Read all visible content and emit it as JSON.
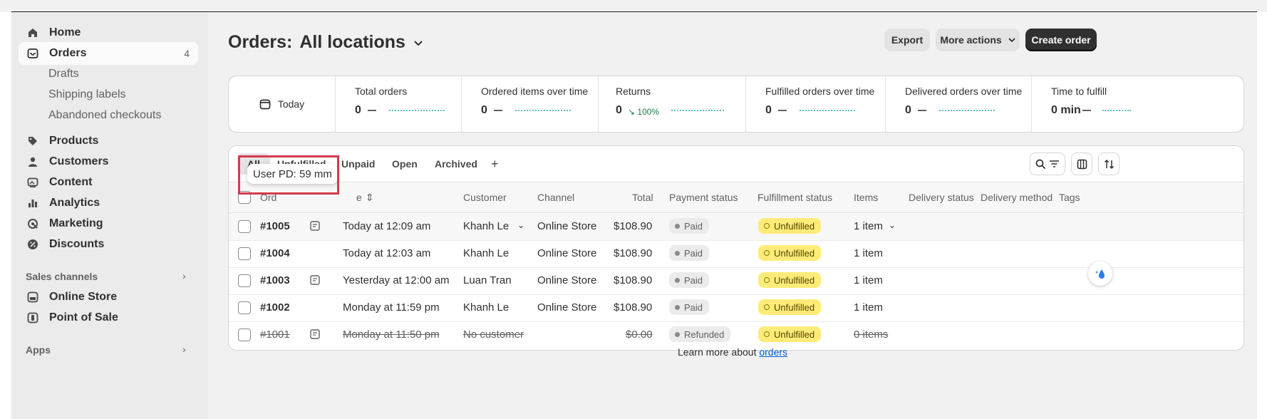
{
  "sidebar": {
    "items": [
      {
        "label": "Home",
        "icon": "home-icon"
      },
      {
        "label": "Orders",
        "icon": "orders-icon",
        "badge": "4"
      },
      {
        "label": "Products",
        "icon": "tag-icon"
      },
      {
        "label": "Customers",
        "icon": "person-icon"
      },
      {
        "label": "Content",
        "icon": "image-icon"
      },
      {
        "label": "Analytics",
        "icon": "bar-chart-icon"
      },
      {
        "label": "Marketing",
        "icon": "target-icon"
      },
      {
        "label": "Discounts",
        "icon": "discount-icon"
      }
    ],
    "orders_sub": [
      "Drafts",
      "Shipping labels",
      "Abandoned checkouts"
    ],
    "sales_channels_label": "Sales channels",
    "sales_channels": [
      {
        "label": "Online Store",
        "icon": "store-icon"
      },
      {
        "label": "Point of Sale",
        "icon": "pos-icon"
      }
    ],
    "apps_label": "Apps"
  },
  "header": {
    "title": "Orders:",
    "location": "All locations",
    "export_label": "Export",
    "more_actions_label": "More actions",
    "create_label": "Create order"
  },
  "metrics": {
    "date_label": "Today",
    "items": [
      {
        "label": "Total orders",
        "value": "0"
      },
      {
        "label": "Ordered items over time",
        "value": "0"
      },
      {
        "label": "Returns",
        "value": "0",
        "pct": "100%"
      },
      {
        "label": "Fulfilled orders over time",
        "value": "0"
      },
      {
        "label": "Delivered orders over time",
        "value": "0"
      },
      {
        "label": "Time to fulfill",
        "value": "0 min"
      }
    ]
  },
  "tabs": [
    "All",
    "Unfulfilled",
    "Unpaid",
    "Open",
    "Archived"
  ],
  "add_tab": "+",
  "table": {
    "headers": {
      "order": "Ord",
      "date": "e",
      "customer": "Customer",
      "channel": "Channel",
      "total": "Total",
      "payment": "Payment status",
      "fulfillment": "Fulfillment status",
      "items": "Items",
      "delivery_status": "Delivery status",
      "delivery_method": "Delivery method",
      "tags": "Tags"
    },
    "rows": [
      {
        "order": "#1005",
        "date": "Today at 12:09 am",
        "customer": "Khanh Le",
        "channel": "Online Store",
        "total": "$108.90",
        "payment": "Paid",
        "fulfillment": "Unfulfilled",
        "items": "1 item",
        "note": true
      },
      {
        "order": "#1004",
        "date": "Today at 12:03 am",
        "customer": "Khanh Le",
        "channel": "Online Store",
        "total": "$108.90",
        "payment": "Paid",
        "fulfillment": "Unfulfilled",
        "items": "1 item",
        "note": false
      },
      {
        "order": "#1003",
        "date": "Yesterday at 12:00 am",
        "customer": "Luan Tran",
        "channel": "Online Store",
        "total": "$108.90",
        "payment": "Paid",
        "fulfillment": "Unfulfilled",
        "items": "1 item",
        "note": true
      },
      {
        "order": "#1002",
        "date": "Monday at 11:59 pm",
        "customer": "Khanh Le",
        "channel": "Online Store",
        "total": "$108.90",
        "payment": "Paid",
        "fulfillment": "Unfulfilled",
        "items": "1 item",
        "note": false
      },
      {
        "order": "#1001",
        "date": "Monday at 11:50 pm",
        "customer": "No customer",
        "channel": "",
        "total": "$0.00",
        "payment": "Refunded",
        "fulfillment": "Unfulfilled",
        "items": "0 items",
        "note": true
      }
    ]
  },
  "tooltip": "User PD: 59 mm",
  "footer": {
    "text": "Learn more about",
    "link": "orders"
  },
  "colors": {
    "accent": "#303030",
    "unfulfilled": "#ffeb78",
    "highlight": "#d43a50",
    "link": "#005bd3"
  }
}
